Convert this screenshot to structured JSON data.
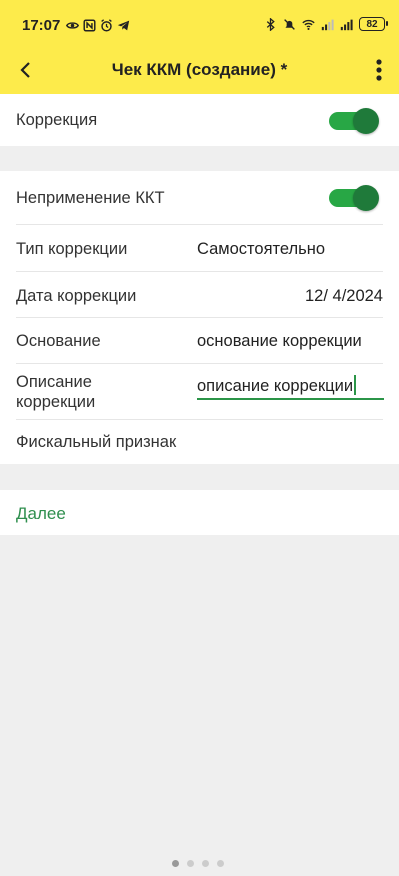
{
  "status_bar": {
    "time": "17:07",
    "battery": "82",
    "left_icons": [
      "eye-icon",
      "nfc-icon",
      "alarm-icon",
      "telegram-icon"
    ],
    "right_icons": [
      "bluetooth-icon",
      "mute-icon",
      "wifi-icon",
      "signal-icon",
      "signal-icon"
    ]
  },
  "app_bar": {
    "title": "Чек ККМ (создание) *",
    "back_icon": "chevron-left-icon",
    "more_icon": "more-vertical-icon"
  },
  "form": {
    "correction": {
      "label": "Коррекция",
      "enabled": true
    },
    "no_kkt": {
      "label": "Неприменение ККТ",
      "enabled": true
    },
    "correction_type": {
      "label": "Тип коррекции",
      "value": "Самостоятельно"
    },
    "correction_date": {
      "label": "Дата коррекции",
      "value": "12/ 4/2024"
    },
    "basis": {
      "label": "Основание",
      "value": "основание коррекции"
    },
    "description": {
      "label_line1": "Описание",
      "label_line2": "коррекции",
      "value": "описание коррекции"
    },
    "fiscal_sign": {
      "label": "Фискальный признак",
      "value": ""
    }
  },
  "actions": {
    "next_label": "Далее"
  },
  "colors": {
    "accent_yellow": "#fdeb4b",
    "accent_green": "#2b9548",
    "toggle_green": "#28a745"
  },
  "pager": {
    "pages": 4,
    "active_index": 0
  }
}
